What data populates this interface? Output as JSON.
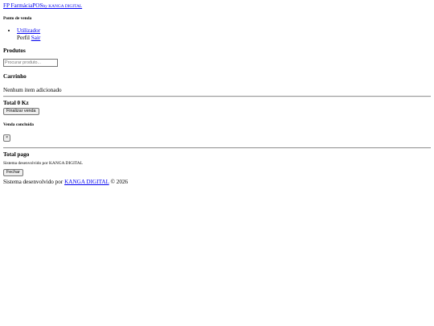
{
  "brand": {
    "prefix": "FP ",
    "name": "FarmáciaPOS",
    "by": "by KANGA DIGITAL"
  },
  "header": {
    "section_title": "Ponto de venda"
  },
  "user_menu": {
    "user_label": "Utilizador",
    "profile_label": "Perfil",
    "logout_label": "Sair"
  },
  "products": {
    "title": "Produtos",
    "search_placeholder": "Procurar produto..."
  },
  "cart": {
    "title": "Carrinho",
    "empty_message": "Nenhum item adicionado",
    "total_label": "Total",
    "total_value": "0 Kz",
    "checkout_button": "Finalizar venda"
  },
  "sale_modal": {
    "title": "Venda concluída",
    "close_symbol": "×",
    "total_paid_label": "Total pago",
    "developer_note": "Sistema desenvolvido por KANGA DIGITAL",
    "close_button": "Fechar"
  },
  "footer": {
    "text_prefix": "Sistema desenvolvido por ",
    "link_text": "KANGA DIGITAL",
    "text_suffix": " © 2026"
  }
}
